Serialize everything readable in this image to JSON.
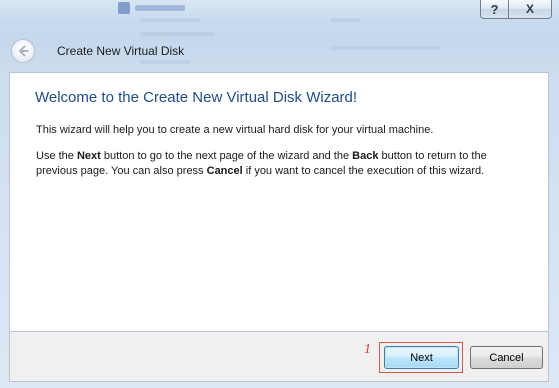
{
  "window": {
    "title": "Create New Virtual Disk",
    "help_glyph": "?",
    "close_glyph": "X",
    "back_icon": "back-arrow-icon"
  },
  "wizard": {
    "heading": "Welcome to the Create New Virtual Disk Wizard!",
    "intro": "This wizard will help you to create a new virtual hard disk for your virtual machine.",
    "instructions": {
      "t1": "Use the ",
      "next": "Next",
      "t2": " button to go to the next page of the wizard and the ",
      "back": "Back",
      "t3": " button to return to the previous page. You can also press ",
      "cancel": "Cancel",
      "t4": " if you want to cancel the execution of this wizard."
    }
  },
  "buttons": {
    "next_label": "Next",
    "cancel_label": "Cancel"
  },
  "annotation": {
    "step_number": "1",
    "color": "#d9383a"
  },
  "colors": {
    "heading": "#1e4b8f",
    "frame": "#cfe0f1"
  }
}
